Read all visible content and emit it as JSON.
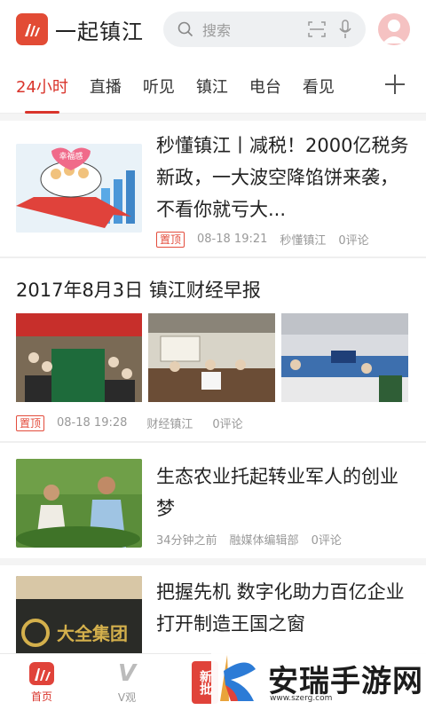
{
  "header": {
    "app_title": "一起镇江",
    "search_placeholder": "搜索"
  },
  "tabs": [
    {
      "label": "24小时"
    },
    {
      "label": "直播"
    },
    {
      "label": "听见"
    },
    {
      "label": "镇江"
    },
    {
      "label": "电台"
    },
    {
      "label": "看见"
    }
  ],
  "articles": {
    "a1": {
      "title": "秒懂镇江丨减税！2000亿税务新政，一大波空降馅饼来袭，不看你就亏大...",
      "badge": "置顶",
      "time": "08-18 19:21",
      "source": "秒懂镇江",
      "comments": "0评论",
      "thumb_text": "幸福感"
    },
    "a2": {
      "title": "2017年8月3日 镇江财经早报",
      "badge": "置顶",
      "time": "08-18 19:28",
      "source": "财经镇江",
      "comments": "0评论"
    },
    "a3": {
      "title": "生态农业托起转业军人的创业梦",
      "time": "34分钟之前",
      "source": "融媒体编辑部",
      "comments": "0评论"
    },
    "a4": {
      "title": "把握先机 数字化助力百亿企业打开制造王国之窗",
      "thumb_text": "大全集团"
    }
  },
  "bottom_nav": {
    "home": "首页",
    "v_icon_text": "V",
    "vguan": "V观",
    "third_text": "新批"
  },
  "watermark": {
    "text": "安瑞手游网",
    "url": "www.szerg.com"
  },
  "colors": {
    "accent": "#d9342b",
    "meta": "#999999"
  }
}
